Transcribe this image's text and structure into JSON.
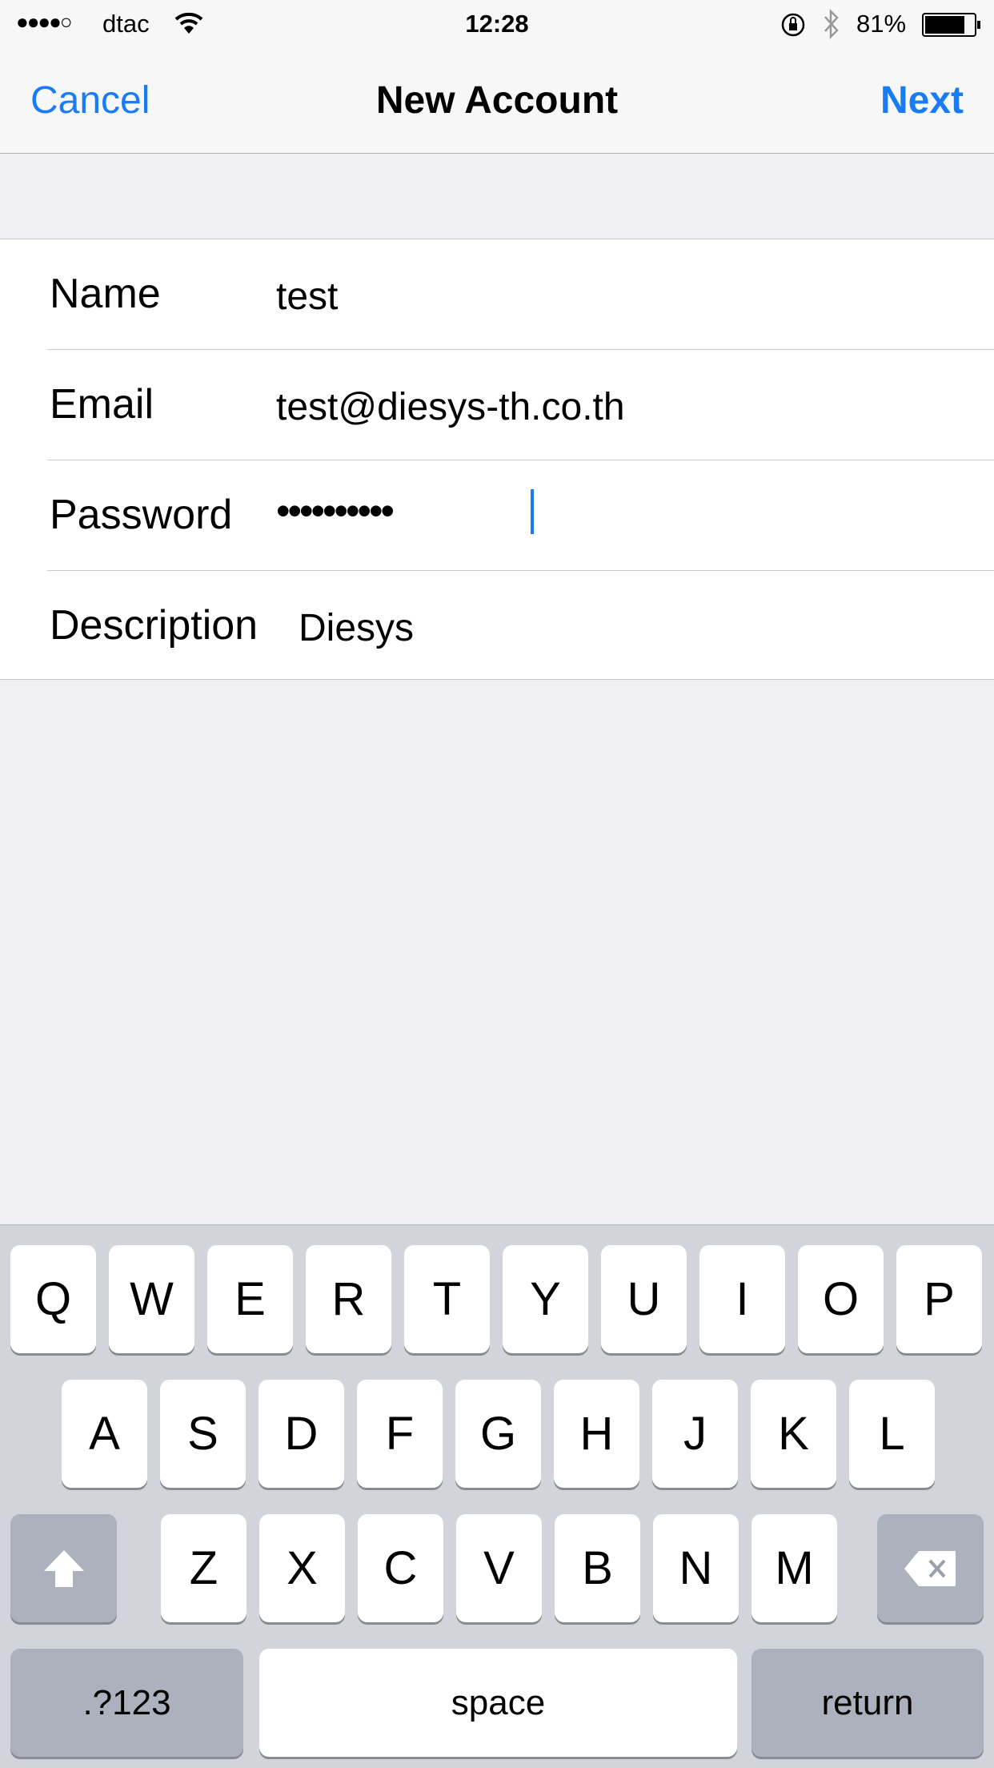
{
  "status_bar": {
    "signal_dots": "●●●●○",
    "carrier": "dtac",
    "time": "12:28",
    "battery": "81%",
    "icons": [
      "wifi-icon",
      "orientation-lock-icon",
      "bluetooth-icon",
      "battery-icon"
    ]
  },
  "nav": {
    "cancel": "Cancel",
    "title": "New Account",
    "next": "Next"
  },
  "form": {
    "rows": [
      {
        "label": "Name",
        "value": "test"
      },
      {
        "label": "Email",
        "value": "test@diesys-th.co.th"
      },
      {
        "label": "Password",
        "value": "••••••••••"
      },
      {
        "label": "Description",
        "value": "Diesys"
      }
    ]
  },
  "keyboard": {
    "row1": [
      "Q",
      "W",
      "E",
      "R",
      "T",
      "Y",
      "U",
      "I",
      "O",
      "P"
    ],
    "row2": [
      "A",
      "S",
      "D",
      "F",
      "G",
      "H",
      "J",
      "K",
      "L"
    ],
    "row3": [
      "Z",
      "X",
      "C",
      "V",
      "B",
      "N",
      "M"
    ],
    "numbers": ".?123",
    "space": "space",
    "return": "return"
  },
  "colors": {
    "accent": "#1a7cf5"
  }
}
